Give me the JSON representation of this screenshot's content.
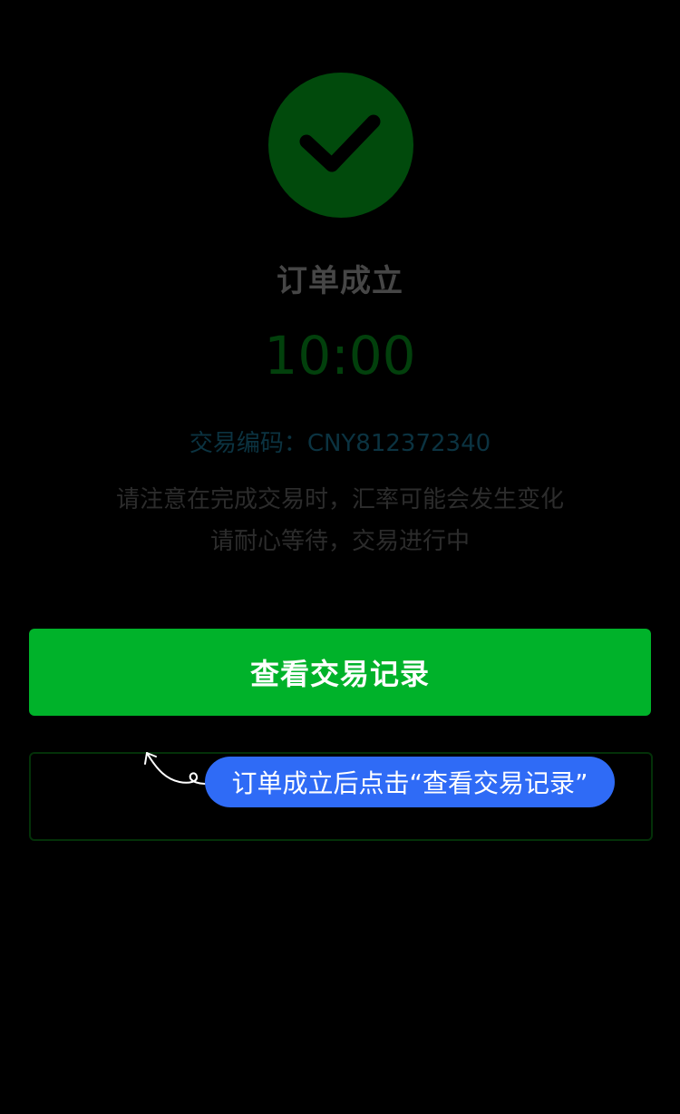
{
  "status": {
    "icon": "checkmark-icon",
    "title": "订单成立",
    "timer": "10:00",
    "trade_code": "交易编码：CNY812372340",
    "notice_line1": "请注意在完成交易时，汇率可能会发生变化",
    "notice_line2": "请耐心等待，交易进行中"
  },
  "actions": {
    "primary_label": "查看交易记录",
    "secondary_label": ""
  },
  "hint": {
    "text": "订单成立后点击“查看交易记录”",
    "arrow_icon": "curved-arrow-icon"
  },
  "colors": {
    "background": "#000000",
    "primary_button": "#00b22a",
    "hint_bubble": "#2f6bf6",
    "success_circle": "#014a0c"
  }
}
